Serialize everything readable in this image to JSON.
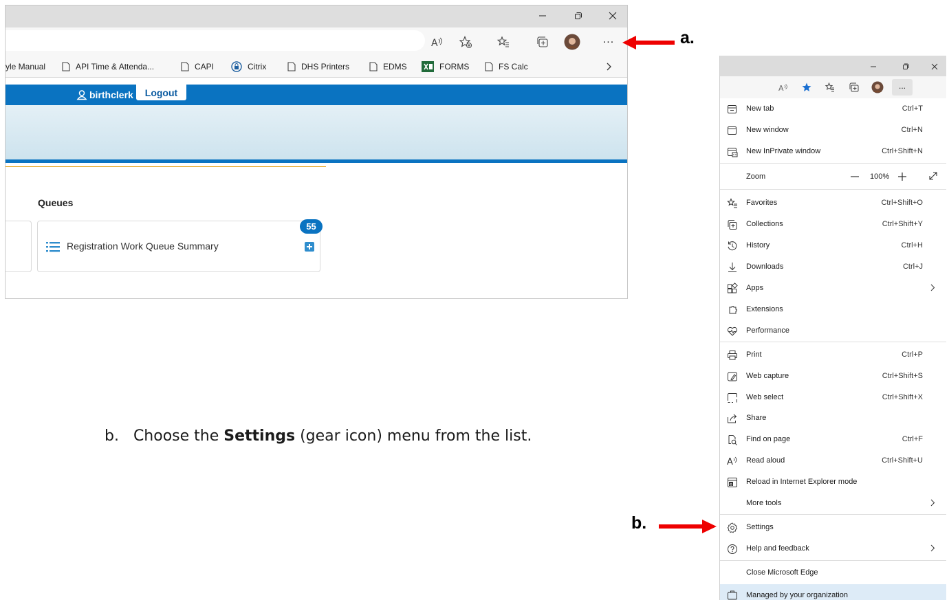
{
  "browser": {
    "bookmarks": [
      {
        "label": "yle Manual"
      },
      {
        "label": "API Time & Attenda..."
      },
      {
        "label": "CAPI"
      },
      {
        "label": "Citrix"
      },
      {
        "label": "DHS Printers"
      },
      {
        "label": "EDMS"
      },
      {
        "label": "FORMS"
      },
      {
        "label": "FS Calc"
      }
    ],
    "user": "birthclerk",
    "logout": "Logout",
    "queues_heading": "Queues",
    "queue_card": {
      "title": "Registration Work Queue Summary",
      "count": "55"
    },
    "more_button": "..."
  },
  "annotations": {
    "label_a": "a.",
    "label_b": "b.",
    "instruction": {
      "prefix": "b.   Choose the ",
      "bold": "Settings",
      "suffix": " (gear icon) menu from the list."
    }
  },
  "menu": {
    "items": [
      {
        "label": "New tab",
        "shortcut": "Ctrl+T",
        "icon": "new-tab-icon"
      },
      {
        "label": "New window",
        "shortcut": "Ctrl+N",
        "icon": "window-icon"
      },
      {
        "label": "New InPrivate window",
        "shortcut": "Ctrl+Shift+N",
        "icon": "inprivate-icon"
      },
      {
        "label": "Favorites",
        "shortcut": "Ctrl+Shift+O",
        "icon": "favorites-icon"
      },
      {
        "label": "Collections",
        "shortcut": "Ctrl+Shift+Y",
        "icon": "collections-icon"
      },
      {
        "label": "History",
        "shortcut": "Ctrl+H",
        "icon": "history-icon"
      },
      {
        "label": "Downloads",
        "shortcut": "Ctrl+J",
        "icon": "download-icon"
      },
      {
        "label": "Apps",
        "shortcut": "",
        "icon": "apps-icon"
      },
      {
        "label": "Extensions",
        "shortcut": "",
        "icon": "extensions-icon"
      },
      {
        "label": "Performance",
        "shortcut": "",
        "icon": "performance-icon"
      },
      {
        "label": "Print",
        "shortcut": "Ctrl+P",
        "icon": "print-icon"
      },
      {
        "label": "Web capture",
        "shortcut": "Ctrl+Shift+S",
        "icon": "web-capture-icon"
      },
      {
        "label": "Web select",
        "shortcut": "Ctrl+Shift+X",
        "icon": "web-select-icon"
      },
      {
        "label": "Share",
        "shortcut": "",
        "icon": "share-icon"
      },
      {
        "label": "Find on page",
        "shortcut": "Ctrl+F",
        "icon": "find-icon"
      },
      {
        "label": "Read aloud",
        "shortcut": "Ctrl+Shift+U",
        "icon": "read-aloud-icon"
      },
      {
        "label": "Reload in Internet Explorer mode",
        "shortcut": "",
        "icon": "ie-mode-icon"
      },
      {
        "label": "More tools",
        "shortcut": "",
        "icon": ""
      },
      {
        "label": "Settings",
        "shortcut": "",
        "icon": "gear-icon"
      },
      {
        "label": "Help and feedback",
        "shortcut": "",
        "icon": "help-icon"
      },
      {
        "label": "Close Microsoft Edge",
        "shortcut": "",
        "icon": ""
      },
      {
        "label": "Managed by your organization",
        "shortcut": "",
        "icon": "briefcase-icon"
      }
    ],
    "zoom": {
      "label": "Zoom",
      "value": "100%"
    }
  },
  "colors": {
    "accent_blue": "#0a73c1",
    "arrow_red": "#ee0000",
    "gold_line": "#e3a21a"
  }
}
